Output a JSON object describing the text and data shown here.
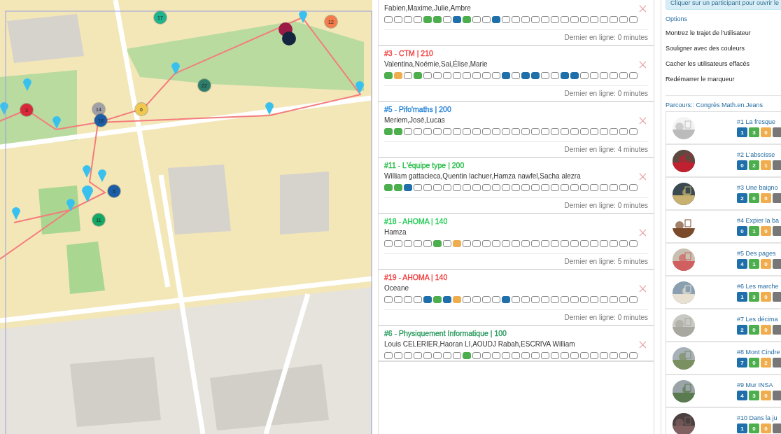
{
  "map": {
    "kind": "picture",
    "markers": [
      {
        "label": "17",
        "color": "#1fb38e"
      },
      {
        "label": "12",
        "color": "#f47b4b"
      },
      {
        "label": "22",
        "color": "#2e7d6c"
      },
      {
        "label": "3",
        "color": "#d8283a"
      },
      {
        "label": "14",
        "color": "#a0a0a8"
      },
      {
        "label": "18",
        "color": "#1b5ea6"
      },
      {
        "label": "6",
        "color": "#f0c850"
      },
      {
        "label": "5",
        "color": "#1b5ea6"
      },
      {
        "label": "11",
        "color": "#14a866"
      }
    ]
  },
  "teams": [
    {
      "members": "Fabien,Maxime,Julie,Ambre",
      "cells": [
        {
          "color": "#ffffff"
        },
        {
          "color": "#ffffff"
        },
        {
          "color": "#ffffff"
        },
        {
          "color": "#ffffff"
        },
        {
          "color": "#4cae4c"
        },
        {
          "color": "#4cae4c"
        },
        {
          "color": "#ffffff"
        },
        {
          "color": "#1f6fab"
        },
        {
          "color": "#4cae4c"
        },
        {
          "color": "#ffffff"
        },
        {
          "color": "#ffffff"
        },
        {
          "color": "#1f6fab"
        },
        {
          "color": "#ffffff"
        },
        {
          "color": "#ffffff"
        },
        {
          "color": "#ffffff"
        },
        {
          "color": "#ffffff"
        },
        {
          "color": "#ffffff"
        },
        {
          "color": "#ffffff"
        },
        {
          "color": "#ffffff"
        },
        {
          "color": "#ffffff"
        },
        {
          "color": "#ffffff"
        },
        {
          "color": "#ffffff"
        },
        {
          "color": "#ffffff"
        },
        {
          "color": "#ffffff"
        },
        {
          "color": "#ffffff"
        },
        {
          "color": "#ffffff"
        }
      ],
      "last_seen": "Dernier en ligne: 0 minutes"
    },
    {
      "header": "#3 - CTM | 210",
      "color": "#f03c3c",
      "members": "Valentina,Noémie,Sai,Élise,Marie",
      "cells": [
        {
          "color": "#4cae4c"
        },
        {
          "color": "#f0ad4e"
        },
        {
          "color": "#ffffff"
        },
        {
          "color": "#4cae4c"
        },
        {
          "color": "#ffffff"
        },
        {
          "color": "#ffffff"
        },
        {
          "color": "#ffffff"
        },
        {
          "color": "#ffffff"
        },
        {
          "color": "#ffffff"
        },
        {
          "color": "#ffffff"
        },
        {
          "color": "#ffffff"
        },
        {
          "color": "#ffffff"
        },
        {
          "color": "#1f6fab"
        },
        {
          "color": "#ffffff"
        },
        {
          "color": "#1f6fab"
        },
        {
          "color": "#1f6fab"
        },
        {
          "color": "#ffffff"
        },
        {
          "color": "#ffffff"
        },
        {
          "color": "#1f6fab"
        },
        {
          "color": "#1f6fab"
        },
        {
          "color": "#ffffff"
        },
        {
          "color": "#ffffff"
        },
        {
          "color": "#ffffff"
        },
        {
          "color": "#ffffff"
        },
        {
          "color": "#ffffff"
        },
        {
          "color": "#ffffff"
        }
      ],
      "last_seen": "Dernier en ligne: 0 minutes"
    },
    {
      "header": "#5 - Pifo'maths | 200",
      "color": "#1e7fd6",
      "members": "Meriem,José,Lucas",
      "cells": [
        {
          "color": "#4cae4c"
        },
        {
          "color": "#4cae4c"
        },
        {
          "color": "#ffffff"
        },
        {
          "color": "#ffffff"
        },
        {
          "color": "#ffffff"
        },
        {
          "color": "#ffffff"
        },
        {
          "color": "#ffffff"
        },
        {
          "color": "#ffffff"
        },
        {
          "color": "#ffffff"
        },
        {
          "color": "#ffffff"
        },
        {
          "color": "#ffffff"
        },
        {
          "color": "#ffffff"
        },
        {
          "color": "#ffffff"
        },
        {
          "color": "#ffffff"
        },
        {
          "color": "#ffffff"
        },
        {
          "color": "#ffffff"
        },
        {
          "color": "#ffffff"
        },
        {
          "color": "#ffffff"
        },
        {
          "color": "#ffffff"
        },
        {
          "color": "#ffffff"
        },
        {
          "color": "#ffffff"
        },
        {
          "color": "#ffffff"
        },
        {
          "color": "#ffffff"
        },
        {
          "color": "#ffffff"
        },
        {
          "color": "#ffffff"
        },
        {
          "color": "#ffffff"
        }
      ],
      "last_seen": "Dernier en ligne: 4 minutes"
    },
    {
      "header": "#11 - L'équipe type | 200",
      "color": "#22bb44",
      "members": "William gattacieca,Quentin lachuer,Hamza nawfel,Sacha alezra",
      "cells": [
        {
          "color": "#4cae4c"
        },
        {
          "color": "#4cae4c"
        },
        {
          "color": "#1f6fab"
        },
        {
          "color": "#ffffff"
        },
        {
          "color": "#ffffff"
        },
        {
          "color": "#ffffff"
        },
        {
          "color": "#ffffff"
        },
        {
          "color": "#ffffff"
        },
        {
          "color": "#ffffff"
        },
        {
          "color": "#ffffff"
        },
        {
          "color": "#ffffff"
        },
        {
          "color": "#ffffff"
        },
        {
          "color": "#ffffff"
        },
        {
          "color": "#ffffff"
        },
        {
          "color": "#ffffff"
        },
        {
          "color": "#ffffff"
        },
        {
          "color": "#ffffff"
        },
        {
          "color": "#ffffff"
        },
        {
          "color": "#ffffff"
        },
        {
          "color": "#ffffff"
        },
        {
          "color": "#ffffff"
        },
        {
          "color": "#ffffff"
        },
        {
          "color": "#ffffff"
        },
        {
          "color": "#ffffff"
        },
        {
          "color": "#ffffff"
        },
        {
          "color": "#ffffff"
        }
      ],
      "last_seen": "Dernier en ligne: 0 minutes"
    },
    {
      "header": "#18 - AHOMA | 140",
      "color": "#22cc55",
      "members": "Hamza",
      "cells": [
        {
          "color": "#ffffff"
        },
        {
          "color": "#ffffff"
        },
        {
          "color": "#ffffff"
        },
        {
          "color": "#ffffff"
        },
        {
          "color": "#ffffff"
        },
        {
          "color": "#4cae4c"
        },
        {
          "color": "#ffffff"
        },
        {
          "color": "#f0ad4e"
        },
        {
          "color": "#ffffff"
        },
        {
          "color": "#ffffff"
        },
        {
          "color": "#ffffff"
        },
        {
          "color": "#ffffff"
        },
        {
          "color": "#ffffff"
        },
        {
          "color": "#ffffff"
        },
        {
          "color": "#ffffff"
        },
        {
          "color": "#ffffff"
        },
        {
          "color": "#ffffff"
        },
        {
          "color": "#ffffff"
        },
        {
          "color": "#ffffff"
        },
        {
          "color": "#ffffff"
        },
        {
          "color": "#ffffff"
        },
        {
          "color": "#ffffff"
        },
        {
          "color": "#ffffff"
        },
        {
          "color": "#ffffff"
        },
        {
          "color": "#ffffff"
        },
        {
          "color": "#ffffff"
        }
      ],
      "last_seen": "Dernier en ligne: 5 minutes"
    },
    {
      "header": "#19 - AHOMA | 140",
      "color": "#f03c3c",
      "members": "Oceane",
      "cells": [
        {
          "color": "#ffffff"
        },
        {
          "color": "#ffffff"
        },
        {
          "color": "#ffffff"
        },
        {
          "color": "#ffffff"
        },
        {
          "color": "#1f6fab"
        },
        {
          "color": "#4cae4c"
        },
        {
          "color": "#1f6fab"
        },
        {
          "color": "#f0ad4e"
        },
        {
          "color": "#ffffff"
        },
        {
          "color": "#ffffff"
        },
        {
          "color": "#ffffff"
        },
        {
          "color": "#ffffff"
        },
        {
          "color": "#1f6fab"
        },
        {
          "color": "#ffffff"
        },
        {
          "color": "#ffffff"
        },
        {
          "color": "#ffffff"
        },
        {
          "color": "#ffffff"
        },
        {
          "color": "#ffffff"
        },
        {
          "color": "#ffffff"
        },
        {
          "color": "#ffffff"
        },
        {
          "color": "#ffffff"
        },
        {
          "color": "#ffffff"
        },
        {
          "color": "#ffffff"
        },
        {
          "color": "#ffffff"
        },
        {
          "color": "#ffffff"
        },
        {
          "color": "#ffffff"
        }
      ],
      "last_seen": "Dernier en ligne: 0 minutes"
    },
    {
      "header": "#6 - Physiquement Informatique | 100",
      "color": "#2a9a5e",
      "members": "Louis CELERIER,Haoran LI,AOUDJ Rabah,ESCRIVA William",
      "cells": [
        {
          "color": "#ffffff"
        },
        {
          "color": "#ffffff"
        },
        {
          "color": "#ffffff"
        },
        {
          "color": "#ffffff"
        },
        {
          "color": "#ffffff"
        },
        {
          "color": "#ffffff"
        },
        {
          "color": "#ffffff"
        },
        {
          "color": "#ffffff"
        },
        {
          "color": "#4cae4c"
        },
        {
          "color": "#ffffff"
        },
        {
          "color": "#ffffff"
        },
        {
          "color": "#ffffff"
        },
        {
          "color": "#ffffff"
        },
        {
          "color": "#ffffff"
        },
        {
          "color": "#ffffff"
        },
        {
          "color": "#ffffff"
        },
        {
          "color": "#ffffff"
        },
        {
          "color": "#ffffff"
        },
        {
          "color": "#ffffff"
        },
        {
          "color": "#ffffff"
        },
        {
          "color": "#ffffff"
        },
        {
          "color": "#ffffff"
        },
        {
          "color": "#ffffff"
        },
        {
          "color": "#ffffff"
        },
        {
          "color": "#ffffff"
        },
        {
          "color": "#ffffff"
        }
      ]
    }
  ],
  "info": "Cliquer sur un participant pour ouvrir le",
  "options": {
    "title": "Options",
    "items": [
      "Montrez le trajet de l'utilisateur",
      "Souligner avec des couleurs",
      "Cacher les utilisateurs effacés",
      "Redémarrer le marqueur"
    ]
  },
  "parcours": {
    "title": "Parcours:: Congrès Math.en.Jeans",
    "items": [
      {
        "title": "#1 La fresque",
        "badges": [
          {
            "text": "1",
            "color": "#1f6fab"
          },
          {
            "text": "3",
            "color": "#4cae4c"
          },
          {
            "text": "0",
            "color": "#f0ad4e"
          },
          {
            "color": "#777777"
          }
        ]
      },
      {
        "title": "#2 L'abscisse",
        "badges": [
          {
            "text": "0",
            "color": "#1f6fab"
          },
          {
            "text": "2",
            "color": "#4cae4c"
          },
          {
            "text": "1",
            "color": "#f0ad4e"
          },
          {
            "color": "#777777"
          }
        ]
      },
      {
        "title": "#3 Une baigno",
        "badges": [
          {
            "text": "2",
            "color": "#1f6fab"
          },
          {
            "text": "0",
            "color": "#4cae4c"
          },
          {
            "text": "0",
            "color": "#f0ad4e"
          },
          {
            "color": "#777777"
          }
        ]
      },
      {
        "title": "#4 Expier la ba",
        "badges": [
          {
            "text": "0",
            "color": "#1f6fab"
          },
          {
            "text": "1",
            "color": "#4cae4c"
          },
          {
            "text": "0",
            "color": "#f0ad4e"
          },
          {
            "color": "#777777"
          }
        ]
      },
      {
        "title": "#5 Des pages",
        "badges": [
          {
            "text": "4",
            "color": "#1f6fab"
          },
          {
            "text": "1",
            "color": "#4cae4c"
          },
          {
            "text": "0",
            "color": "#f0ad4e"
          },
          {
            "color": "#777777"
          }
        ]
      },
      {
        "title": "#6 Les marche",
        "badges": [
          {
            "text": "1",
            "color": "#1f6fab"
          },
          {
            "text": "3",
            "color": "#4cae4c"
          },
          {
            "text": "0",
            "color": "#f0ad4e"
          },
          {
            "color": "#777777"
          }
        ]
      },
      {
        "title": "#7 Les décima",
        "badges": [
          {
            "text": "2",
            "color": "#1f6fab"
          },
          {
            "text": "0",
            "color": "#4cae4c"
          },
          {
            "text": "0",
            "color": "#f0ad4e"
          },
          {
            "color": "#777777"
          }
        ]
      },
      {
        "title": "#8 Mont Cindre",
        "badges": [
          {
            "text": "7",
            "color": "#1f6fab"
          },
          {
            "text": "0",
            "color": "#4cae4c"
          },
          {
            "text": "2",
            "color": "#f0ad4e"
          },
          {
            "color": "#777777"
          }
        ]
      },
      {
        "title": "#9 Mur INSA",
        "badges": [
          {
            "text": "4",
            "color": "#1f6fab"
          },
          {
            "text": "3",
            "color": "#4cae4c"
          },
          {
            "text": "0",
            "color": "#f0ad4e"
          },
          {
            "color": "#777777"
          }
        ]
      },
      {
        "title": "#10 Dans la ju",
        "badges": [
          {
            "text": "1",
            "color": "#1f6fab"
          },
          {
            "text": "0",
            "color": "#4cae4c"
          },
          {
            "text": "0",
            "color": "#f0ad4e"
          },
          {
            "color": "#777777"
          }
        ]
      }
    ]
  }
}
